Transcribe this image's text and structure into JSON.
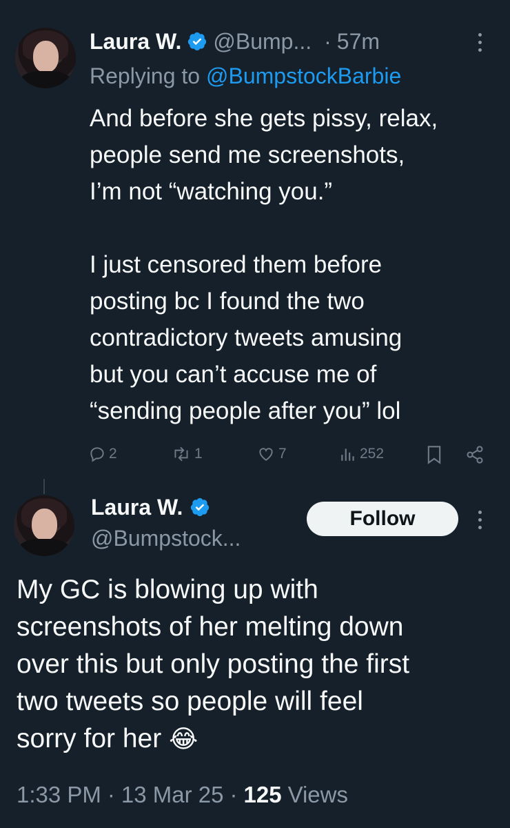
{
  "reply_tweet": {
    "display_name": "Laura W.",
    "handle": "@Bump...",
    "separator": "·",
    "time": "57m",
    "replying_prefix": "Replying to",
    "replying_to": "@BumpstockBarbie",
    "text": "And before she gets pissy, relax,\npeople send me screenshots,\nI’m not “watching you.”\n\nI just censored them before\nposting bc I found the two\ncontradictory tweets amusing\nbut you can’t accuse me of\n“sending people after you” lol",
    "actions": {
      "replies": "2",
      "reposts": "1",
      "likes": "7",
      "views": "252"
    }
  },
  "main_tweet": {
    "display_name": "Laura W.",
    "handle": "@Bumpstock...",
    "follow_label": "Follow",
    "text": "My GC is blowing up with\nscreenshots of her melting down\nover this but only posting the first\ntwo tweets so people will feel\nsorry for her",
    "emoji": "😂",
    "time": "1:33 PM",
    "date": "13 Mar 25",
    "views_count": "125",
    "views_label": "Views",
    "separator": "·"
  },
  "colors": {
    "background": "#15202b",
    "text": "#f7f9f9",
    "muted": "#8b98a5",
    "link": "#1d9bf0",
    "verified": "#1d9bf0"
  }
}
